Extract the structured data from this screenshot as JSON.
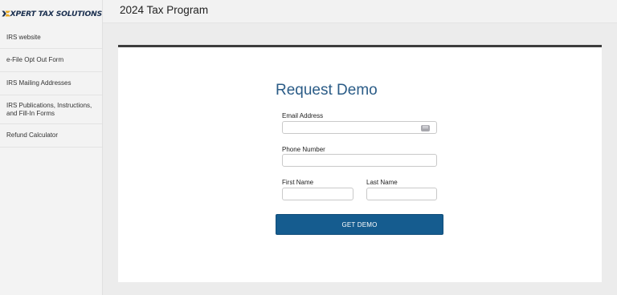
{
  "brand": {
    "logo_text": "XPERT TAX SOLUTIONS",
    "colors": {
      "navy": "#1a2f4f",
      "gold": "#e8a820"
    }
  },
  "sidebar": {
    "items": [
      {
        "label": "IRS website"
      },
      {
        "label": "e-File Opt Out Form"
      },
      {
        "label": "IRS Mailing Addresses"
      },
      {
        "label": "IRS Publications, Instructions, and Fill-In Forms"
      },
      {
        "label": "Refund Calculator"
      }
    ]
  },
  "header": {
    "title": "2024 Tax Program"
  },
  "form": {
    "title": "Request Demo",
    "email": {
      "label": "Email Address",
      "value": "",
      "icon": "keyboard-autofill-icon"
    },
    "phone": {
      "label": "Phone Number",
      "value": ""
    },
    "first_name": {
      "label": "First Name",
      "value": ""
    },
    "last_name": {
      "label": "Last Name",
      "value": ""
    },
    "submit_label": "GET DEMO"
  },
  "colors": {
    "accent": "#155c8f",
    "title": "#2b5c87",
    "card_border": "#3d3d3d"
  }
}
